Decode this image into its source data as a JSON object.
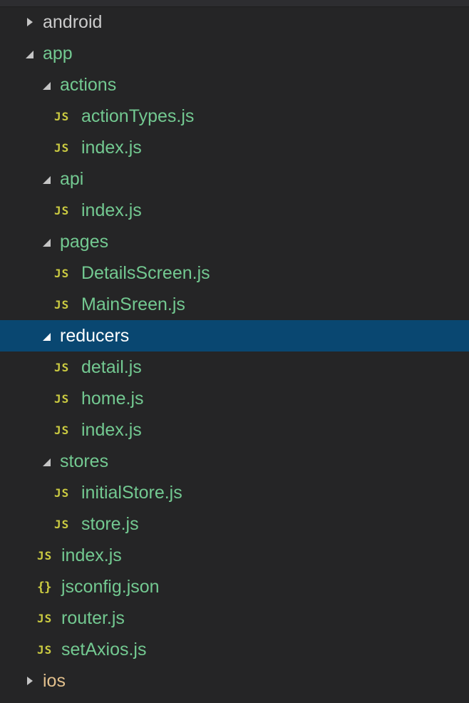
{
  "explorer": {
    "accent_color": "#094771",
    "modified_color": "#73c991",
    "js_icon_color": "#cbcb41",
    "items": [
      {
        "label": "android",
        "type": "folder",
        "state": "collapsed",
        "depth": 0,
        "icon": "chevron-right-icon"
      },
      {
        "label": "app",
        "type": "folder",
        "state": "expanded",
        "depth": 0,
        "icon": "chevron-down-icon"
      },
      {
        "label": "actions",
        "type": "folder",
        "state": "expanded",
        "depth": 1,
        "icon": "chevron-down-icon"
      },
      {
        "label": "actionTypes.js",
        "type": "file",
        "depth": 2,
        "icon": "JS"
      },
      {
        "label": "index.js",
        "type": "file",
        "depth": 2,
        "icon": "JS"
      },
      {
        "label": "api",
        "type": "folder",
        "state": "expanded",
        "depth": 1,
        "icon": "chevron-down-icon"
      },
      {
        "label": "index.js",
        "type": "file",
        "depth": 2,
        "icon": "JS"
      },
      {
        "label": "pages",
        "type": "folder",
        "state": "expanded",
        "depth": 1,
        "icon": "chevron-down-icon"
      },
      {
        "label": "DetailsScreen.js",
        "type": "file",
        "depth": 2,
        "icon": "JS"
      },
      {
        "label": "MainSreen.js",
        "type": "file",
        "depth": 2,
        "icon": "JS"
      },
      {
        "label": "reducers",
        "type": "folder",
        "state": "expanded",
        "depth": 1,
        "icon": "chevron-down-icon",
        "selected": true
      },
      {
        "label": "detail.js",
        "type": "file",
        "depth": 2,
        "icon": "JS"
      },
      {
        "label": "home.js",
        "type": "file",
        "depth": 2,
        "icon": "JS"
      },
      {
        "label": "index.js",
        "type": "file",
        "depth": 2,
        "icon": "JS"
      },
      {
        "label": "stores",
        "type": "folder",
        "state": "expanded",
        "depth": 1,
        "icon": "chevron-down-icon"
      },
      {
        "label": "initialStore.js",
        "type": "file",
        "depth": 2,
        "icon": "JS"
      },
      {
        "label": "store.js",
        "type": "file",
        "depth": 2,
        "icon": "JS"
      },
      {
        "label": "index.js",
        "type": "file",
        "depth": 1,
        "icon": "JS"
      },
      {
        "label": "jsconfig.json",
        "type": "file",
        "depth": 1,
        "icon": "{}"
      },
      {
        "label": "router.js",
        "type": "file",
        "depth": 1,
        "icon": "JS"
      },
      {
        "label": "setAxios.js",
        "type": "file",
        "depth": 1,
        "icon": "JS"
      },
      {
        "label": "ios",
        "type": "folder",
        "state": "collapsed",
        "depth": 0,
        "icon": "chevron-right-icon"
      }
    ]
  }
}
